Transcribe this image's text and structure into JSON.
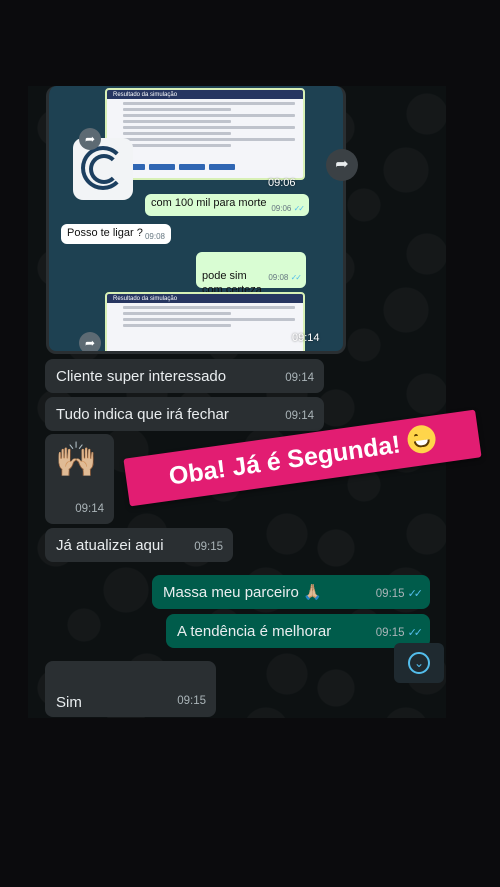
{
  "inner_screenshot": {
    "sim_title": "Resultado da simulação",
    "inner_messages": [
      {
        "text": "com 100 mil para morte",
        "time": "09:06",
        "direction": "out"
      },
      {
        "text": "Posso te ligar ?",
        "time": "09:08",
        "direction": "in"
      },
      {
        "text": "pode sim\ncom certeza",
        "time": "09:08",
        "direction": "out"
      }
    ],
    "top_time": "09:06",
    "bottom_time": "09:14"
  },
  "messages": [
    {
      "text": "Cliente super interessado",
      "time": "09:14",
      "direction": "in"
    },
    {
      "text": "Tudo indica que irá fechar",
      "time": "09:14",
      "direction": "in"
    },
    {
      "text": "🙌🏼",
      "time": "09:14",
      "direction": "in"
    },
    {
      "text": "Já atualizei aqui",
      "time": "09:15",
      "direction": "in"
    },
    {
      "text": "Massa meu parceiro 🙏🏼",
      "time": "09:15",
      "direction": "out"
    },
    {
      "text": "A tendência é melhorar",
      "time": "09:15",
      "direction": "out"
    },
    {
      "text": "Sim\nCom certeza!",
      "time": "09:15",
      "direction": "in"
    }
  ],
  "sticker": {
    "text": "Oba! Já é Segunda!",
    "emoji": "grinning-face",
    "color": "#e21d72"
  },
  "colors": {
    "incoming": "#2a2f32",
    "outgoing": "#005c4b",
    "ticks": "#53bdeb"
  },
  "icons": {
    "share": "share-icon",
    "scroll": "chevron-down-icon",
    "ticks": "double-check-icon"
  }
}
